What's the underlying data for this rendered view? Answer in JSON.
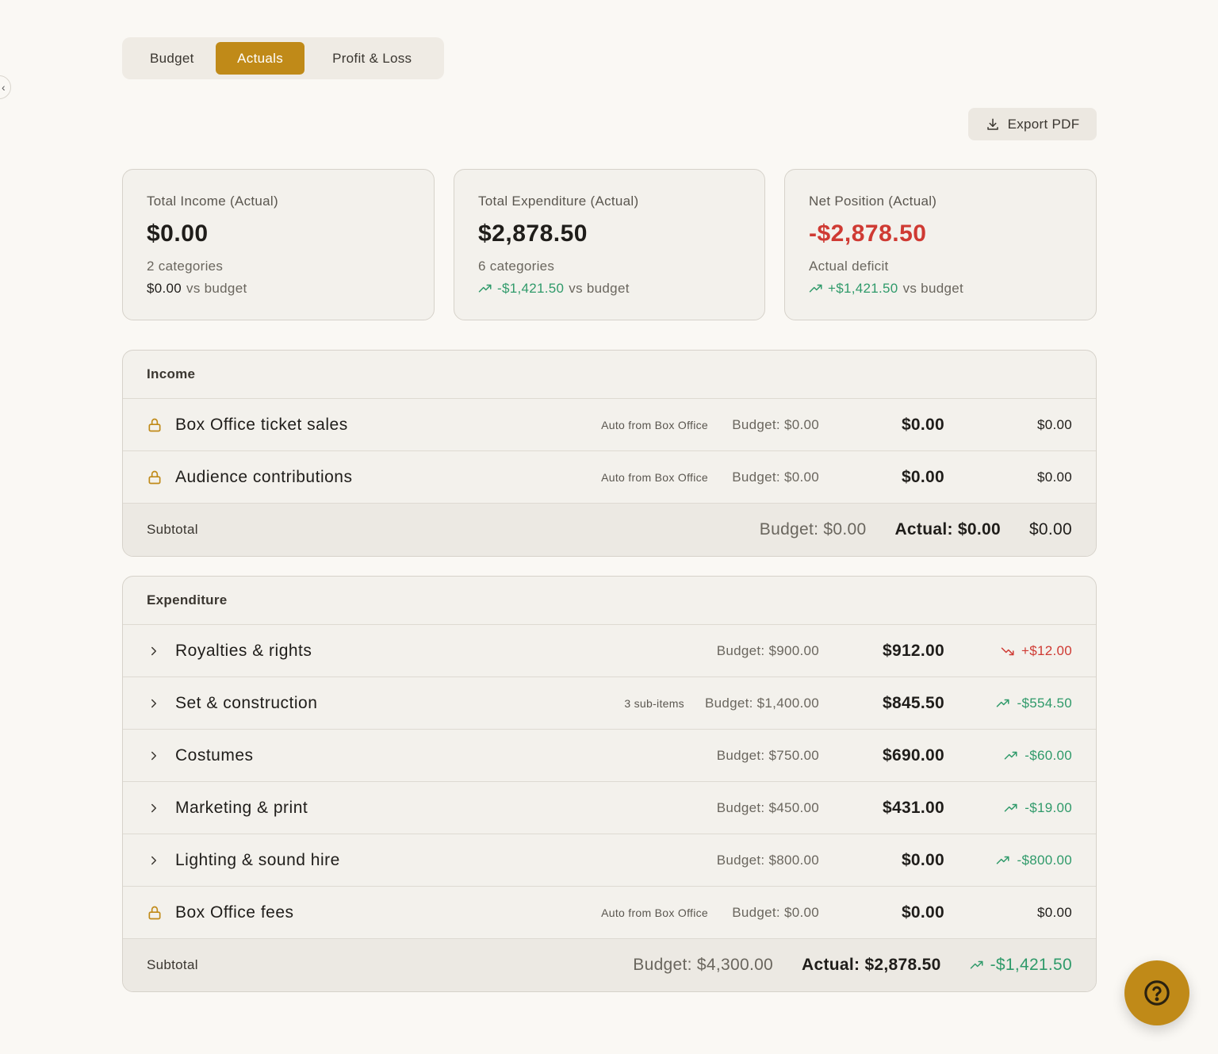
{
  "tabs": {
    "budget": "Budget",
    "actuals": "Actuals",
    "pnl": "Profit & Loss"
  },
  "export_label": "Export PDF",
  "cards": {
    "income": {
      "label": "Total Income (Actual)",
      "value": "$0.00",
      "sub": "2 categories",
      "cmp_value": "$0.00",
      "cmp_suffix": "vs budget"
    },
    "expenditure": {
      "label": "Total Expenditure (Actual)",
      "value": "$2,878.50",
      "sub": "6 categories",
      "cmp_value": "-$1,421.50",
      "cmp_suffix": "vs budget"
    },
    "net": {
      "label": "Net Position (Actual)",
      "value": "-$2,878.50",
      "sub": "Actual deficit",
      "cmp_value": "+$1,421.50",
      "cmp_suffix": "vs budget"
    }
  },
  "income": {
    "title": "Income",
    "rows": [
      {
        "name": "Box Office ticket sales",
        "tag": "Auto from Box Office",
        "budget": "Budget: $0.00",
        "actual": "$0.00",
        "variance": "$0.00"
      },
      {
        "name": "Audience contributions",
        "tag": "Auto from Box Office",
        "budget": "Budget: $0.00",
        "actual": "$0.00",
        "variance": "$0.00"
      }
    ],
    "subtotal": {
      "label": "Subtotal",
      "budget": "Budget: $0.00",
      "actual": "Actual: $0.00",
      "variance": "$0.00"
    }
  },
  "expenditure": {
    "title": "Expenditure",
    "rows": [
      {
        "name": "Royalties & rights",
        "tag": "",
        "budget": "Budget: $900.00",
        "actual": "$912.00",
        "variance": "+$12.00"
      },
      {
        "name": "Set & construction",
        "tag": "3 sub-items",
        "budget": "Budget: $1,400.00",
        "actual": "$845.50",
        "variance": "-$554.50"
      },
      {
        "name": "Costumes",
        "tag": "",
        "budget": "Budget: $750.00",
        "actual": "$690.00",
        "variance": "-$60.00"
      },
      {
        "name": "Marketing & print",
        "tag": "",
        "budget": "Budget: $450.00",
        "actual": "$431.00",
        "variance": "-$19.00"
      },
      {
        "name": "Lighting & sound hire",
        "tag": "",
        "budget": "Budget: $800.00",
        "actual": "$0.00",
        "variance": "-$800.00"
      },
      {
        "name": "Box Office fees",
        "tag": "Auto from Box Office",
        "budget": "Budget: $0.00",
        "actual": "$0.00",
        "variance": "$0.00"
      }
    ],
    "subtotal": {
      "label": "Subtotal",
      "budget": "Budget: $4,300.00",
      "actual": "Actual: $2,878.50",
      "variance": "-$1,421.50"
    }
  },
  "colors": {
    "accent": "#c08a18",
    "positive": "#2f9a6a",
    "negative": "#cf3a33"
  }
}
